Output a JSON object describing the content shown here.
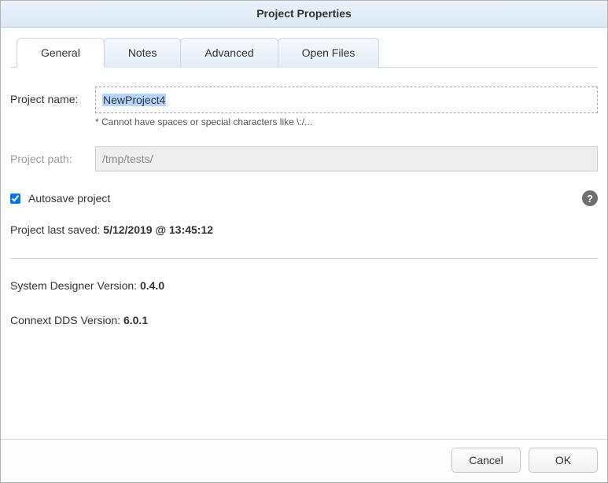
{
  "dialog": {
    "title": "Project Properties"
  },
  "tabs": [
    {
      "label": "General",
      "active": true
    },
    {
      "label": "Notes",
      "active": false
    },
    {
      "label": "Advanced",
      "active": false
    },
    {
      "label": "Open Files",
      "active": false
    }
  ],
  "form": {
    "project_name": {
      "label": "Project name:",
      "value": "NewProject4",
      "hint": "* Cannot have spaces or special characters like \\:/..."
    },
    "project_path": {
      "label": "Project path:",
      "value": "/tmp/tests/"
    },
    "autosave": {
      "label": "Autosave project",
      "checked": true
    }
  },
  "info": {
    "last_saved": {
      "label": "Project last saved: ",
      "value": "5/12/2019 @ 13:45:12"
    },
    "system_designer_version": {
      "label": "System Designer Version: ",
      "value": "0.4.0"
    },
    "connext_dds_version": {
      "label": "Connext DDS Version: ",
      "value": "6.0.1"
    }
  },
  "footer": {
    "cancel": "Cancel",
    "ok": "OK"
  },
  "icons": {
    "help": "?"
  }
}
